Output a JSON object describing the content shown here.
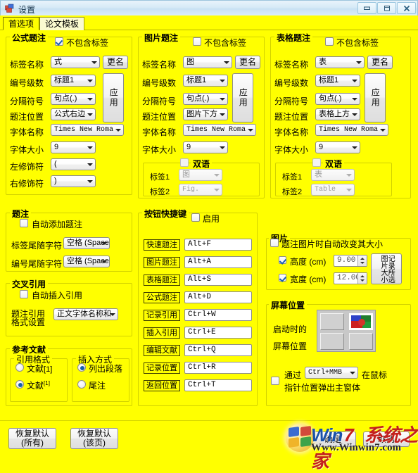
{
  "window": {
    "title": "设置",
    "icon": "app-blocks-icon",
    "buttons": {
      "minimize": "—",
      "maximize": "□",
      "close": "✕"
    }
  },
  "tabs": [
    {
      "label": "首选项",
      "active": true
    },
    {
      "label": "论文模板",
      "active": false
    }
  ],
  "formula_caption": {
    "title": "公式题注",
    "no_label_checkbox": {
      "label": "不包含标签",
      "checked": true
    },
    "rename_button": "更名",
    "apply_button": "应用",
    "fields": [
      {
        "label": "标签名称",
        "value": "式"
      },
      {
        "label": "编号级数",
        "value": "标题1"
      },
      {
        "label": "分隔符号",
        "value": "句点(.)"
      },
      {
        "label": "题注位置",
        "value": "公式右边"
      },
      {
        "label": "字体名称",
        "value": "Times New Roma"
      },
      {
        "label": "字体大小",
        "value": "9"
      },
      {
        "label": "左修饰符",
        "value": "("
      },
      {
        "label": "右修饰符",
        "value": ")"
      }
    ]
  },
  "image_caption": {
    "title": "图片题注",
    "no_label_checkbox": {
      "label": "不包含标签",
      "checked": false
    },
    "rename_button": "更名",
    "apply_button": "应用",
    "fields": [
      {
        "label": "标签名称",
        "value": "图"
      },
      {
        "label": "编号级数",
        "value": "标题1"
      },
      {
        "label": "分隔符号",
        "value": "句点(.)"
      },
      {
        "label": "题注位置",
        "value": "图片下方"
      },
      {
        "label": "字体名称",
        "value": "Times New Roma"
      },
      {
        "label": "字体大小",
        "value": "9"
      }
    ],
    "bilingual": {
      "title": "双语",
      "checked": false,
      "label1": {
        "label": "标签1",
        "value": "图"
      },
      "label2": {
        "label": "标签2",
        "value": "Fig."
      }
    }
  },
  "table_caption": {
    "title": "表格题注",
    "no_label_checkbox": {
      "label": "不包含标签",
      "checked": false
    },
    "rename_button": "更名",
    "apply_button": "应用",
    "fields": [
      {
        "label": "标签名称",
        "value": "表"
      },
      {
        "label": "编号级数",
        "value": "标题1"
      },
      {
        "label": "分隔符号",
        "value": "句点(.)"
      },
      {
        "label": "题注位置",
        "value": "表格上方"
      },
      {
        "label": "字体名称",
        "value": "Times New Roma"
      },
      {
        "label": "字体大小",
        "value": "9"
      }
    ],
    "bilingual": {
      "title": "双语",
      "checked": false,
      "label1": {
        "label": "标签1",
        "value": "表"
      },
      "label2": {
        "label": "标签2",
        "value": "Table"
      }
    }
  },
  "caption_section": {
    "title": "题注",
    "auto_add": {
      "label": "自动添加题注",
      "checked": false
    },
    "label_trailing": {
      "label": "标签尾随字符",
      "value": "空格 (Space"
    },
    "number_trailing": {
      "label": "编号尾随字符",
      "value": "空格 (Space"
    }
  },
  "cross_reference": {
    "title": "交叉引用",
    "auto_insert": {
      "label": "自动插入引用",
      "checked": false
    },
    "format_label_line1": "题注引用",
    "format_label_line2": "格式设置",
    "format_value": "正文字体名称和"
  },
  "references": {
    "title": "参考文献",
    "cite_format": {
      "title": "引用格式",
      "options": [
        {
          "label": "文献",
          "suffix": "[1]",
          "superscript": false,
          "selected": false
        },
        {
          "label": "文献",
          "suffix": "[1]",
          "superscript": true,
          "selected": true
        }
      ]
    },
    "insert_method": {
      "title": "插入方式",
      "options": [
        {
          "label": "列出段落",
          "selected": true
        },
        {
          "label": "尾注",
          "selected": false
        }
      ]
    }
  },
  "shortcuts": {
    "title": "按钮快捷键",
    "enable": {
      "label": "启用",
      "checked": false
    },
    "items": [
      {
        "name": "快速题注",
        "key": "Alt+F"
      },
      {
        "name": "图片题注",
        "key": "Alt+A"
      },
      {
        "name": "表格题注",
        "key": "Alt+S"
      },
      {
        "name": "公式题注",
        "key": "Alt+D"
      },
      {
        "name": "记录引用",
        "key": "Ctrl+W"
      },
      {
        "name": "插入引用",
        "key": "Ctrl+E"
      },
      {
        "name": "编辑文献",
        "key": "Ctrl+Q"
      },
      {
        "name": "记录位置",
        "key": "Ctrl+R"
      },
      {
        "name": "返回位置",
        "key": "Ctrl+T"
      }
    ]
  },
  "picture": {
    "title": "图片",
    "auto_resize": {
      "label": "题注图片时自动改变其大小",
      "checked": false
    },
    "height": {
      "label": "高度 (cm)",
      "checked": true,
      "value": "9.00"
    },
    "width": {
      "label": "宽度 (cm)",
      "checked": true,
      "value": "12.00"
    },
    "record_button": "记录所选图片大小"
  },
  "screen_position": {
    "title": "屏幕位置",
    "label_line1": "启动时的",
    "label_line2": "屏幕位置",
    "selected_cell": "top-right",
    "popup": {
      "prefix": "通过",
      "key": "Ctrl+MMB",
      "suffix": "在鼠标",
      "line2": "指针位置弹出主窗体",
      "checked": false
    }
  },
  "footer": {
    "restore_all_line1": "恢复默认",
    "restore_all_line2": "(所有)",
    "restore_page_line1": "恢复默认",
    "restore_page_line2": "(该页)",
    "ok": "确定",
    "cancel": "取消"
  },
  "watermark": {
    "brand_win": "Win",
    "brand_seven": "7",
    "brand_cn": "系统之家",
    "url": "Www.Winwin7.com"
  },
  "colors": {
    "background": "#ffff00",
    "title_bar": "#d7eaf7",
    "group_border": "#d2d200",
    "accent": "#1560a8"
  }
}
